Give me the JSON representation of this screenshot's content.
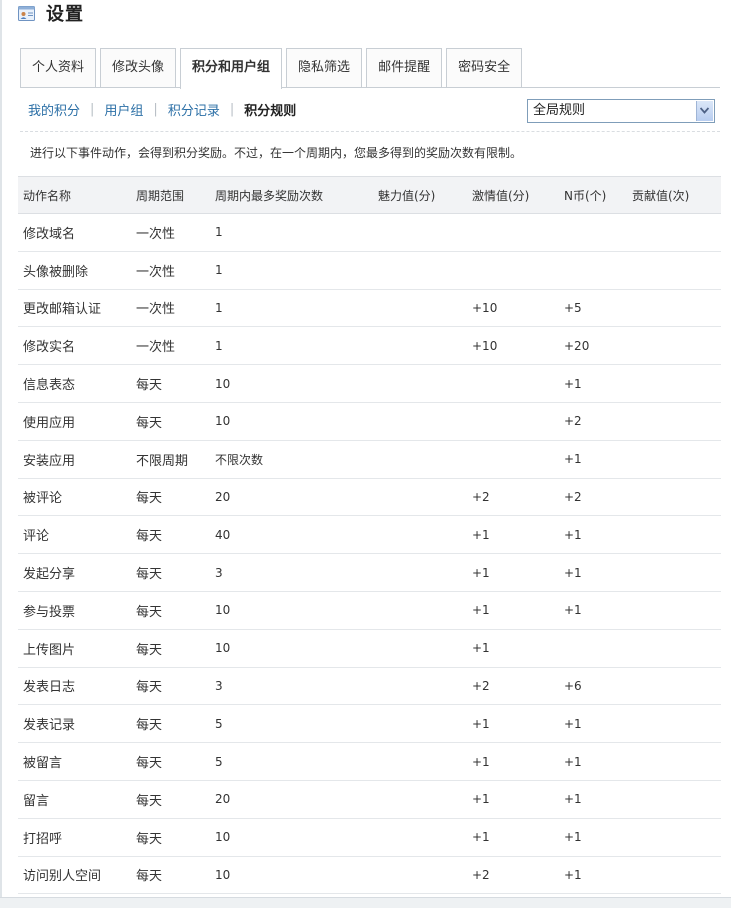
{
  "header": {
    "title": "设置",
    "icon": "profile-card-icon"
  },
  "tabs": [
    {
      "label": "个人资料",
      "active": false
    },
    {
      "label": "修改头像",
      "active": false
    },
    {
      "label": "积分和用户组",
      "active": true
    },
    {
      "label": "隐私筛选",
      "active": false
    },
    {
      "label": "邮件提醒",
      "active": false
    },
    {
      "label": "密码安全",
      "active": false
    }
  ],
  "subnav": {
    "items": [
      {
        "label": "我的积分"
      },
      {
        "label": "用户组"
      },
      {
        "label": "积分记录"
      }
    ],
    "current": "积分规则"
  },
  "scope_select": {
    "value": "全局规则"
  },
  "intro": "进行以下事件动作，会得到积分奖励。不过，在一个周期内，您最多得到的奖励次数有限制。",
  "table": {
    "columns": [
      "动作名称",
      "周期范围",
      "周期内最多奖励次数",
      "魅力值(分)",
      "激情值(分)",
      "N币(个)",
      "贡献值(次)"
    ],
    "rows": [
      [
        "修改域名",
        "一次性",
        "1",
        "",
        "",
        "",
        ""
      ],
      [
        "头像被删除",
        "一次性",
        "1",
        "",
        "",
        "",
        ""
      ],
      [
        "更改邮箱认证",
        "一次性",
        "1",
        "",
        "+10",
        "+5",
        ""
      ],
      [
        "修改实名",
        "一次性",
        "1",
        "",
        "+10",
        "+20",
        ""
      ],
      [
        "信息表态",
        "每天",
        "10",
        "",
        "",
        "+1",
        ""
      ],
      [
        "使用应用",
        "每天",
        "10",
        "",
        "",
        "+2",
        ""
      ],
      [
        "安装应用",
        "不限周期",
        "不限次数",
        "",
        "",
        "+1",
        ""
      ],
      [
        "被评论",
        "每天",
        "20",
        "",
        "+2",
        "+2",
        ""
      ],
      [
        "评论",
        "每天",
        "40",
        "",
        "+1",
        "+1",
        ""
      ],
      [
        "发起分享",
        "每天",
        "3",
        "",
        "+1",
        "+1",
        ""
      ],
      [
        "参与投票",
        "每天",
        "10",
        "",
        "+1",
        "+1",
        ""
      ],
      [
        "上传图片",
        "每天",
        "10",
        "",
        "+1",
        "",
        ""
      ],
      [
        "发表日志",
        "每天",
        "3",
        "",
        "+2",
        "+6",
        ""
      ],
      [
        "发表记录",
        "每天",
        "5",
        "",
        "+1",
        "+1",
        ""
      ],
      [
        "被留言",
        "每天",
        "5",
        "",
        "+1",
        "+1",
        ""
      ],
      [
        "留言",
        "每天",
        "20",
        "",
        "+1",
        "+1",
        ""
      ],
      [
        "打招呼",
        "每天",
        "10",
        "",
        "+1",
        "+1",
        ""
      ],
      [
        "访问别人空间",
        "每天",
        "10",
        "",
        "+2",
        "+1",
        ""
      ]
    ]
  }
}
